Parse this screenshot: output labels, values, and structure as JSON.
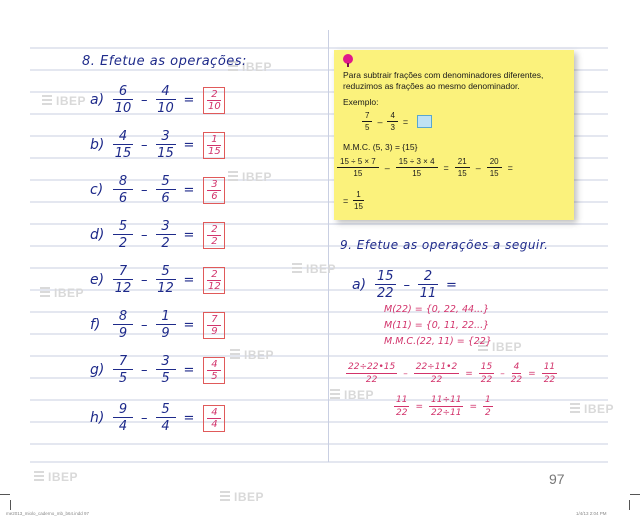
{
  "watermark": "IBEP",
  "q8": {
    "heading": "8. Efetue as operações:",
    "items": [
      {
        "label": "a)",
        "a": {
          "n": "6",
          "d": "10"
        },
        "op": "–",
        "b": {
          "n": "4",
          "d": "10"
        },
        "eq": "=",
        "ans": {
          "n": "2",
          "d": "10"
        }
      },
      {
        "label": "b)",
        "a": {
          "n": "4",
          "d": "15"
        },
        "op": "–",
        "b": {
          "n": "3",
          "d": "15"
        },
        "eq": "=",
        "ans": {
          "n": "1",
          "d": "15"
        }
      },
      {
        "label": "c)",
        "a": {
          "n": "8",
          "d": "6"
        },
        "op": "–",
        "b": {
          "n": "5",
          "d": "6"
        },
        "eq": "=",
        "ans": {
          "n": "3",
          "d": "6"
        }
      },
      {
        "label": "d)",
        "a": {
          "n": "5",
          "d": "2"
        },
        "op": "–",
        "b": {
          "n": "3",
          "d": "2"
        },
        "eq": "=",
        "ans": {
          "n": "2",
          "d": "2"
        }
      },
      {
        "label": "e)",
        "a": {
          "n": "7",
          "d": "12"
        },
        "op": "–",
        "b": {
          "n": "5",
          "d": "12"
        },
        "eq": "=",
        "ans": {
          "n": "2",
          "d": "12"
        }
      },
      {
        "label": "f)",
        "a": {
          "n": "8",
          "d": "9"
        },
        "op": "–",
        "b": {
          "n": "1",
          "d": "9"
        },
        "eq": "=",
        "ans": {
          "n": "7",
          "d": "9"
        }
      },
      {
        "label": "g)",
        "a": {
          "n": "7",
          "d": "5"
        },
        "op": "–",
        "b": {
          "n": "3",
          "d": "5"
        },
        "eq": "=",
        "ans": {
          "n": "4",
          "d": "5"
        }
      },
      {
        "label": "h)",
        "a": {
          "n": "9",
          "d": "4"
        },
        "op": "–",
        "b": {
          "n": "5",
          "d": "4"
        },
        "eq": "=",
        "ans": {
          "n": "4",
          "d": "4"
        }
      }
    ]
  },
  "note": {
    "text": "Para subtrair frações com denominadores diferentes, reduzimos as frações ao mesmo denominador.",
    "example_label": "Exemplo:",
    "f1": {
      "n": "7",
      "d": "5"
    },
    "minus": "–",
    "f2": {
      "n": "4",
      "d": "3"
    },
    "eq": "=",
    "mmc": "M.M.C. (5, 3) = {15}",
    "step1": {
      "n": "15 ÷ 5 × 7",
      "d": "15"
    },
    "step2": {
      "n": "15 ÷ 3 × 4",
      "d": "15"
    },
    "step3": {
      "n": "21",
      "d": "15"
    },
    "step4": {
      "n": "20",
      "d": "15"
    },
    "result": {
      "n": "1",
      "d": "15"
    }
  },
  "q9": {
    "heading": "9. Efetue as operações a seguir.",
    "label": "a)",
    "f1": {
      "n": "15",
      "d": "22"
    },
    "minus": "–",
    "f2": {
      "n": "2",
      "d": "11"
    },
    "eq": "=",
    "m1": "M(22) = {0, 22, 44...}",
    "m2": "M(11) = {0, 11, 22...}",
    "m3": "M.M.C.(22, 11) = {22}",
    "row1": [
      {
        "n": "22÷22•15",
        "d": "22"
      },
      {
        "n": "22÷11•2",
        "d": "22"
      },
      {
        "n": "15",
        "d": "22"
      },
      {
        "n": "4",
        "d": "22"
      },
      {
        "n": "11",
        "d": "22"
      }
    ],
    "row2": [
      {
        "n": "11",
        "d": "22"
      },
      {
        "n": "11÷11",
        "d": "22÷11"
      },
      {
        "n": "1",
        "d": "2"
      }
    ]
  },
  "page_number": "97",
  "footer_left": "me2013_miolo_caderno_mb_b64.indd   97",
  "footer_right": "1/4/13   2:04 PM"
}
